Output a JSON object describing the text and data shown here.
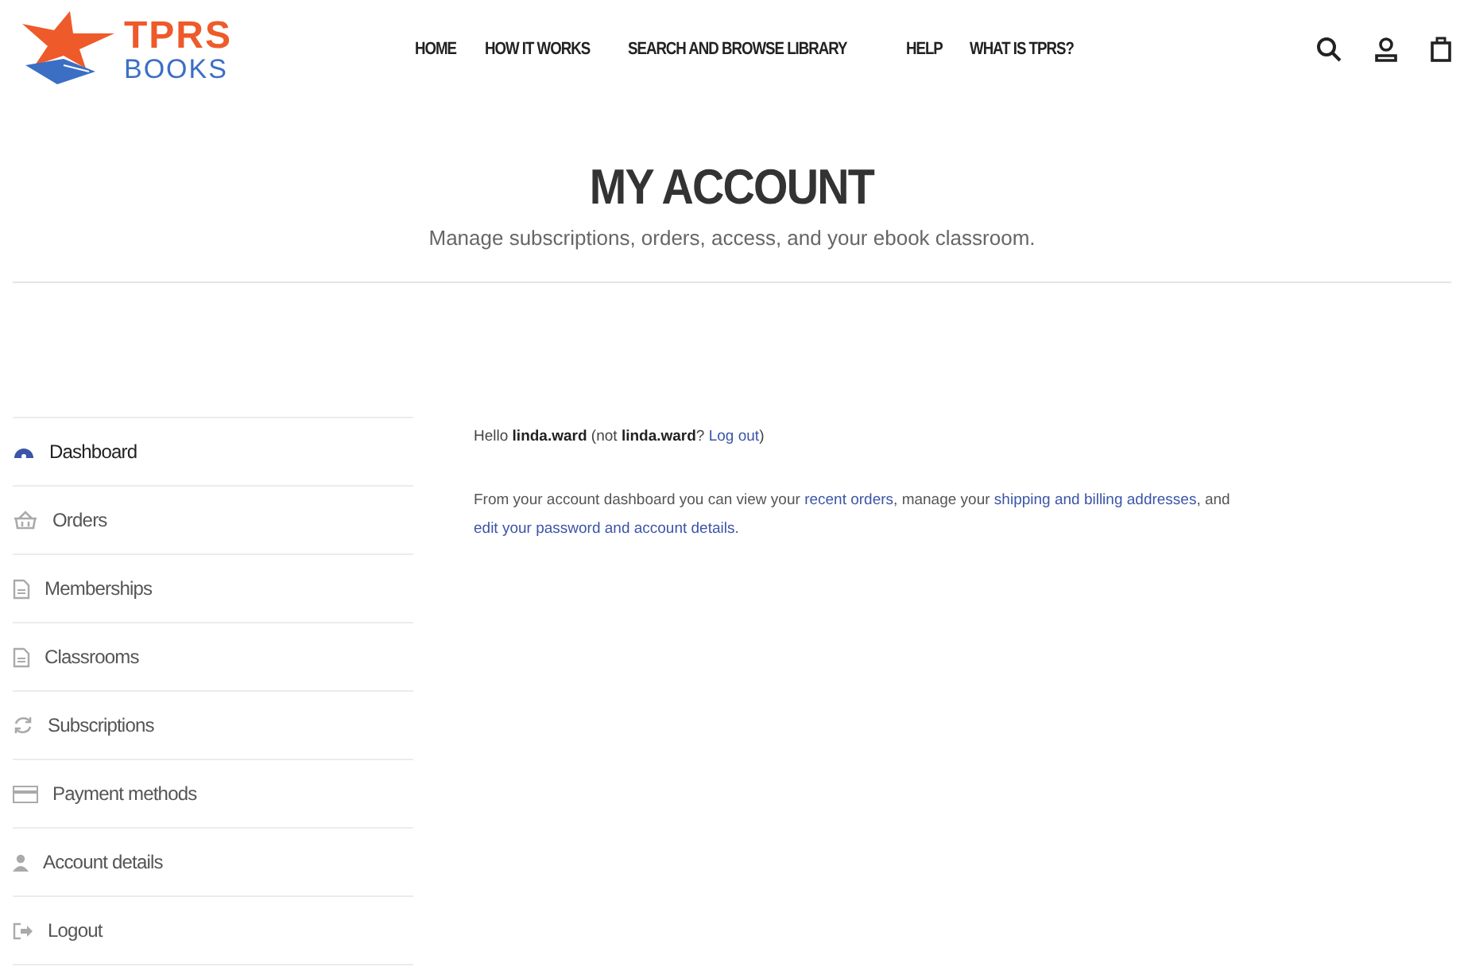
{
  "logo": {
    "top": "TPRS",
    "bottom": "BOOKS"
  },
  "nav": [
    {
      "label": "HOME"
    },
    {
      "label": "HOW IT WORKS"
    },
    {
      "label": "SEARCH AND BROWSE LIBRARY"
    },
    {
      "label": "HELP"
    },
    {
      "label": "WHAT IS TPRS?"
    }
  ],
  "page": {
    "title": "MY ACCOUNT",
    "subtitle": "Manage subscriptions, orders, access, and your ebook classroom."
  },
  "sidebar": {
    "items": [
      {
        "label": "Dashboard",
        "selected": true
      },
      {
        "label": "Orders",
        "selected": false
      },
      {
        "label": "Memberships",
        "selected": false
      },
      {
        "label": "Classrooms",
        "selected": false
      },
      {
        "label": "Subscriptions",
        "selected": false
      },
      {
        "label": "Payment methods",
        "selected": false
      },
      {
        "label": "Account details",
        "selected": false
      },
      {
        "label": "Logout",
        "selected": false
      }
    ]
  },
  "greeting": [
    {
      "kind": "text",
      "text": "Hello **linda.ward** (not **linda.ward**? "
    },
    {
      "kind": "link",
      "text": "Log out"
    },
    {
      "kind": "text",
      "text": ")"
    }
  ],
  "intro": [
    {
      "kind": "text",
      "text": "From your account dashboard you can view your "
    },
    {
      "kind": "link",
      "text": "recent orders"
    },
    {
      "kind": "text",
      "text": ", manage your "
    },
    {
      "kind": "link",
      "text": "shipping and billing addresses"
    },
    {
      "kind": "text",
      "text": ", and "
    },
    {
      "kind": "link",
      "text": "edit your password and account details"
    },
    {
      "kind": "text",
      "text": "."
    }
  ]
}
